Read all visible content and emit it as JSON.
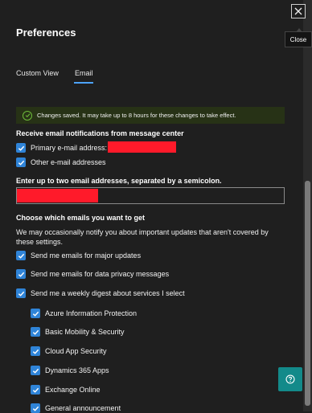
{
  "close_tooltip": "Close",
  "title": "Preferences",
  "tabs": [
    {
      "label": "Custom View"
    },
    {
      "label": "Email"
    }
  ],
  "banner": {
    "text": "Changes saved. It may take up to 8 hours for these changes to take effect."
  },
  "notifications": {
    "heading": "Receive email notifications from message center",
    "primary_label": "Primary e-mail address:",
    "other_label": "Other e-mail addresses"
  },
  "email_input": {
    "heading": "Enter up to two email addresses, separated by a semicolon."
  },
  "choose": {
    "heading": "Choose which emails you want to get",
    "description": "We may occasionally notify you about important updates that aren't covered by these settings.",
    "options": [
      "Send me emails for major updates",
      "Send me emails for data privacy messages",
      "Send me a weekly digest about services I select"
    ]
  },
  "services": [
    "Azure Information Protection",
    "Basic Mobility & Security",
    "Cloud App Security",
    "Dynamics 365 Apps",
    "Exchange Online",
    "General announcement"
  ],
  "colors": {
    "accent": "#2f84d8",
    "banner_bg": "#273216",
    "success": "#6dbb3a",
    "redaction": "#ff1a2a",
    "help_button": "#138a8a"
  },
  "icons": {
    "close": "close-icon",
    "success": "checkmark-circle-icon",
    "checkbox": "checkmark-icon",
    "help": "question-icon"
  }
}
